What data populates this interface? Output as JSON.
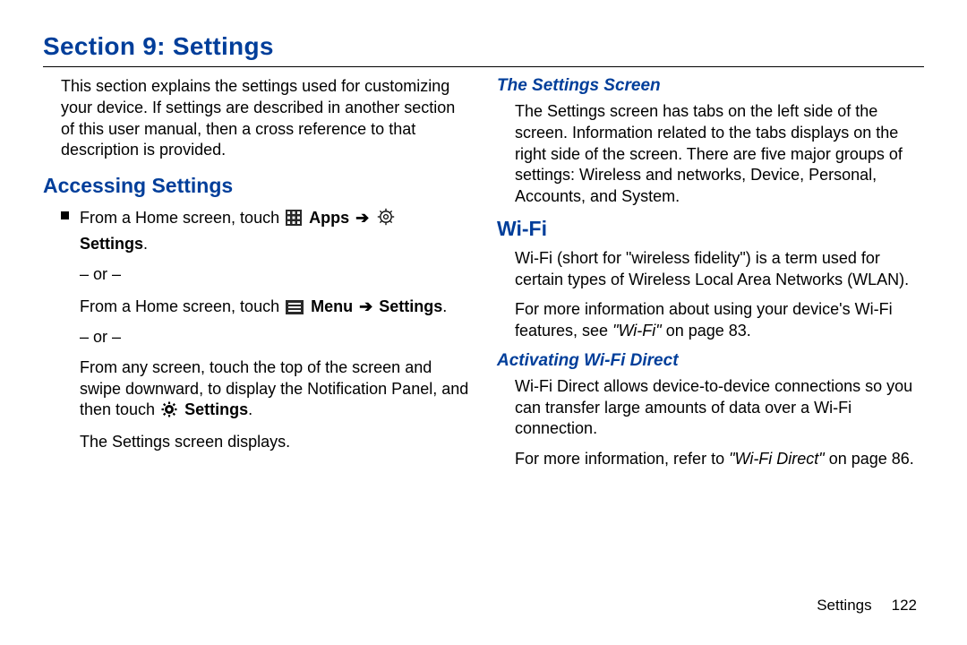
{
  "title": "Section 9: Settings",
  "left": {
    "intro": "This section explains the settings used for customizing your device. If settings are described in another section of this user manual, then a cross reference to that description is provided.",
    "h_access": "Accessing Settings",
    "bullet": {
      "prefix1": "From a Home screen, touch ",
      "apps": "Apps",
      "arrow": "➔",
      "settings1": "Settings",
      "period": ".",
      "or": "– or –",
      "prefix2": "From a Home screen, touch ",
      "menu": "Menu",
      "settings2": "Settings",
      "swipe_a": "From any screen, touch the top of the screen and swipe downward, to display the Notification Panel, and then touch ",
      "settings3": "Settings",
      "after": "The Settings screen displays."
    }
  },
  "right": {
    "h_screen": "The Settings Screen",
    "p_screen": "The Settings screen has tabs on the left side of the screen. Information related to the tabs displays on the right side of the screen. There are five major groups of settings: Wireless and networks, Device, Personal, Accounts, and System.",
    "h_wifi": "Wi-Fi",
    "p_wifi1": "Wi-Fi (short for \"wireless fidelity\") is a term used for certain types of Wireless Local Area Networks (WLAN).",
    "p_wifi2a": "For more information about using your device's Wi-Fi features, see ",
    "p_wifi2b": "\"Wi-Fi\"",
    "p_wifi2c": " on page 83.",
    "h_direct": "Activating Wi-Fi Direct",
    "p_direct1": "Wi-Fi Direct allows device-to-device connections so you can transfer large amounts of data over a Wi-Fi connection.",
    "p_direct2a": "For more information, refer to ",
    "p_direct2b": "\"Wi-Fi Direct\"",
    "p_direct2c": " on page 86."
  },
  "footer": {
    "label": "Settings",
    "page": "122"
  }
}
